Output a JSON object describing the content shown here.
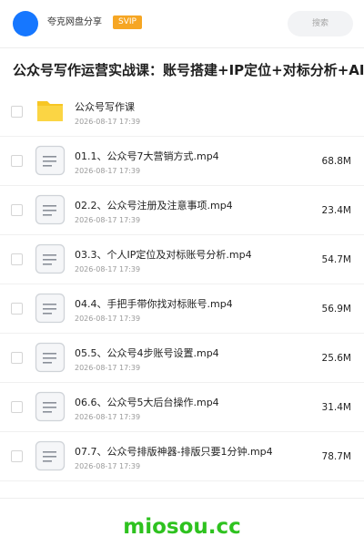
{
  "header": {
    "app_name": "夸克网盘分享",
    "badge": "SVIP",
    "search_placeholder": "搜索",
    "accent_color": "#1677ff",
    "badge_color": "#f6a623"
  },
  "page_title": "公众号写作运营实战课：账号搭建+IP定位+对标分析+AI高",
  "items": [
    {
      "name": "公众号写作课",
      "date": "2026-08-17 17:39",
      "size": "",
      "icon": "folder-icon"
    },
    {
      "name": "01.1、公众号7大营销方式.mp4",
      "date": "2026-08-17 17:39",
      "size": "68.8M",
      "icon": "file-icon"
    },
    {
      "name": "02.2、公众号注册及注意事项.mp4",
      "date": "2026-08-17 17:39",
      "size": "23.4M",
      "icon": "file-icon"
    },
    {
      "name": "03.3、个人IP定位及对标账号分析.mp4",
      "date": "2026-08-17 17:39",
      "size": "54.7M",
      "icon": "file-icon"
    },
    {
      "name": "04.4、手把手带你找对标账号.mp4",
      "date": "2026-08-17 17:39",
      "size": "56.9M",
      "icon": "file-icon"
    },
    {
      "name": "05.5、公众号4步账号设置.mp4",
      "date": "2026-08-17 17:39",
      "size": "25.6M",
      "icon": "file-icon"
    },
    {
      "name": "06.6、公众号5大后台操作.mp4",
      "date": "2026-08-17 17:39",
      "size": "31.4M",
      "icon": "file-icon"
    },
    {
      "name": "07.7、公众号排版神器-排版只要1分钟.mp4",
      "date": "2026-08-17 17:39",
      "size": "78.7M",
      "icon": "file-icon"
    }
  ],
  "watermark": "miosou.cc"
}
